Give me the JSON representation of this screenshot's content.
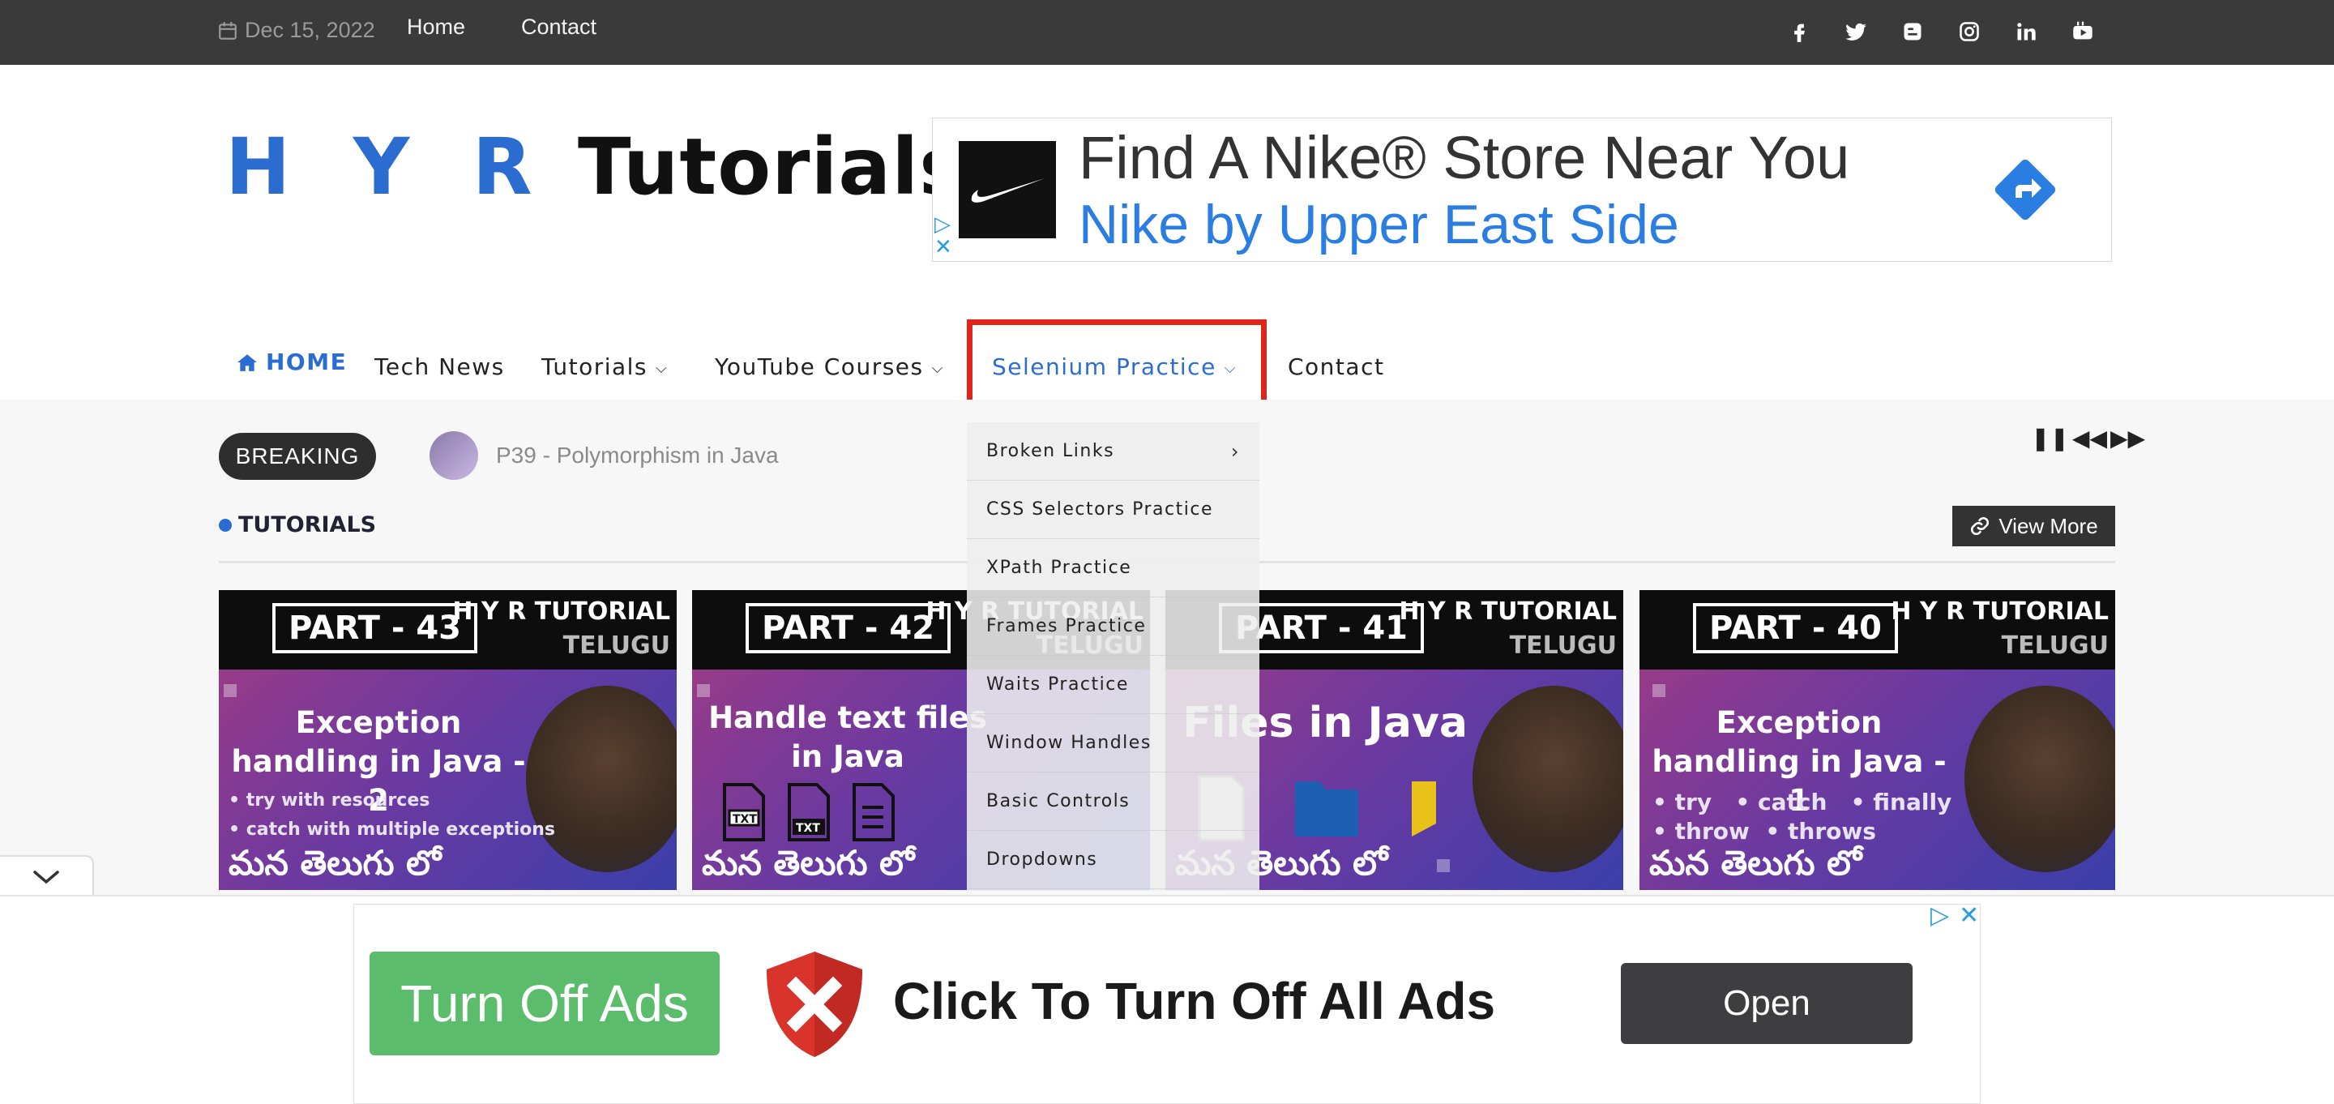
{
  "topbar": {
    "date": "Dec 15, 2022",
    "links": [
      "Home",
      "Contact"
    ],
    "social_icons": [
      "facebook-icon",
      "twitter-icon",
      "blogger-icon",
      "instagram-icon",
      "linkedin-icon",
      "youtube-icon"
    ]
  },
  "header": {
    "logo_part1": "H Y R",
    "logo_part2": " Tutorials"
  },
  "top_ad": {
    "headline": "Find A Nike® Store Near You",
    "subline": "Nike by Upper East Side"
  },
  "nav": {
    "home": "HOME",
    "tech_news": "Tech News",
    "tutorials": "Tutorials",
    "youtube_courses": "YouTube Courses",
    "selenium_practice": "Selenium Practice",
    "contact": "Contact"
  },
  "dropdown": {
    "items": [
      "Broken Links",
      "CSS Selectors Practice",
      "XPath Practice",
      "Frames Practice",
      "Waits Practice",
      "Window Handles",
      "Basic Controls",
      "Dropdowns"
    ]
  },
  "breaking": {
    "label": "BREAKING",
    "headline": "P39 - Polymorphism in Java"
  },
  "tutorials_section": {
    "heading": "TUTORIALS",
    "view_more": "View More"
  },
  "cards": [
    {
      "part": "PART - 43",
      "brand": "H Y R TUTORIAL",
      "brand_sub": "TELUGU",
      "title": "Exception handling in Java - 2",
      "bullets": [
        "• try with resources",
        "• catch with multiple exceptions"
      ],
      "telugu": "మన తెలుగు లో"
    },
    {
      "part": "PART - 42",
      "brand": "H Y R TUTORIAL",
      "brand_sub": "TELUGU",
      "title": "Handle text files in Java",
      "bullets": [],
      "telugu": "మన తెలుగు లో"
    },
    {
      "part": "PART - 41",
      "brand": "H Y R TUTORIAL",
      "brand_sub": "TELUGU",
      "title": "Files in Java",
      "bullets": [],
      "telugu": "మన తెలుగు లో"
    },
    {
      "part": "PART - 40",
      "brand": "H Y R TUTORIAL",
      "brand_sub": "TELUGU",
      "title": "Exception handling in Java - 1",
      "bullets": [
        "• try   • catch   • finally",
        "• throw  • throws"
      ],
      "telugu": "మన తెలుగు లో"
    }
  ],
  "bottom_ad": {
    "turn_off": "Turn Off Ads",
    "headline": "Click To Turn Off All Ads",
    "open": "Open"
  },
  "colors": {
    "accent_blue": "#2b6cd1",
    "highlight_red": "#e0261b",
    "topbar": "#3a3a3a",
    "green_button": "#5bbd6b"
  }
}
